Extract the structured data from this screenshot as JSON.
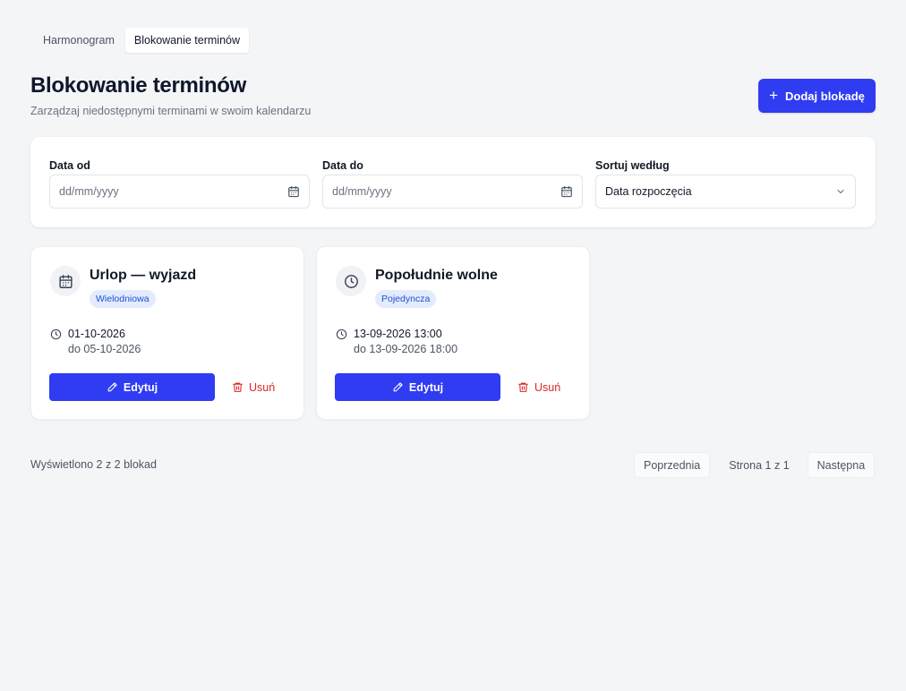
{
  "tabs": [
    {
      "label": "Harmonogram",
      "active": false
    },
    {
      "label": "Blokowanie terminów",
      "active": true
    }
  ],
  "header": {
    "title": "Blokowanie terminów",
    "subtitle": "Zarządzaj niedostępnymi terminami w swoim kalendarzu",
    "add_button_label": "Dodaj blokadę",
    "add_button_icon": "plus-icon"
  },
  "filters": {
    "date_from": {
      "label": "Data od",
      "placeholder": "dd/mm/yyyy",
      "icon": "calendar-icon"
    },
    "date_to": {
      "label": "Data do",
      "placeholder": "dd/mm/yyyy",
      "icon": "calendar-icon"
    },
    "sort": {
      "label": "Sortuj według",
      "value": "Data rozpoczęcia",
      "icon": "chevron-down-icon"
    }
  },
  "blocks": [
    {
      "title": "Urlop — wyjazd",
      "icon": "calendar-icon",
      "badge": "Wielodniowa",
      "from": "01-10-2026",
      "to": "do 05-10-2026",
      "edit_label": "Edytuj",
      "delete_label": "Usuń"
    },
    {
      "title": "Popołudnie wolne",
      "icon": "clock-icon",
      "badge": "Pojedyncza",
      "from": "13-09-2026 13:00",
      "to": "do 13-09-2026 18:00",
      "edit_label": "Edytuj",
      "delete_label": "Usuń"
    }
  ],
  "footer": {
    "count_text": "Wyświetlono 2 z 2 blokad",
    "prev_label": "Poprzednia",
    "page_info": "Strona 1 z 1",
    "next_label": "Następna"
  },
  "colors": {
    "primary": "#2f3cf2",
    "danger": "#dc2626",
    "badge_bg": "#e3ecfd",
    "badge_text": "#1d4ed8",
    "background": "#f4f5f7"
  }
}
